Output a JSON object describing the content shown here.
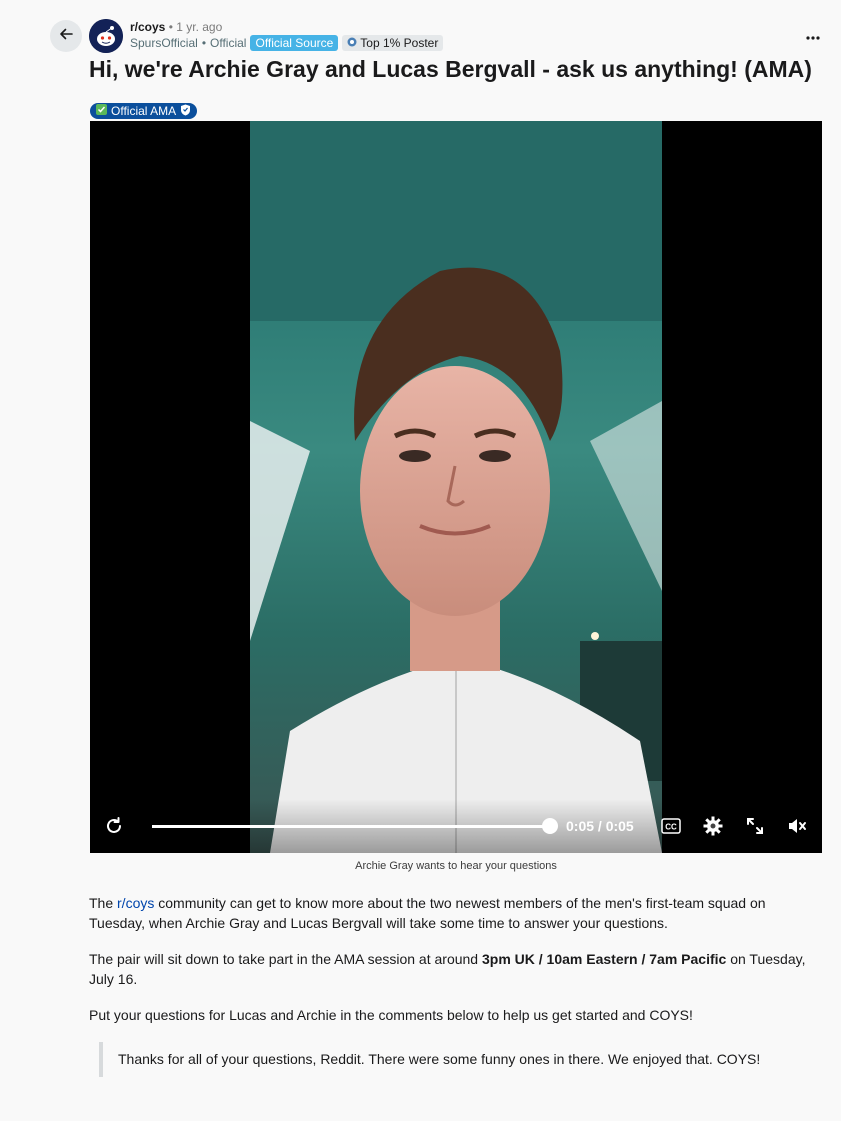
{
  "header": {
    "subreddit": "r/coys",
    "separator": "•",
    "time_ago": "1 yr. ago",
    "username": "SpursOfficial",
    "user_separator": "•",
    "user_label": "Official",
    "flair_source": "Official Source",
    "flair_top": "Top 1% Poster"
  },
  "post": {
    "title": "Hi, we're Archie Gray and Lucas Bergvall - ask us anything! (AMA)",
    "flair": "Official AMA"
  },
  "video": {
    "time_display": "0:05 / 0:05",
    "progress": 1.0,
    "cc_label": "CC",
    "caption": "Archie Gray wants to hear your questions"
  },
  "body": {
    "p1_pre": "The ",
    "p1_link": "r/coys",
    "p1_post": " community can get to know more about the two newest members of the men's first-team squad on Tuesday, when Archie Gray and Lucas Bergvall will take some time to answer your questions.",
    "p2_pre": "The pair will sit down to take part in the AMA session at around ",
    "p2_bold": "3pm UK / 10am Eastern / 7am Pacific",
    "p2_post": " on Tuesday, July 16.",
    "p3": "Put your questions for Lucas and Archie in the comments below to help us get started and COYS!",
    "quote": "Thanks for all of your questions, Reddit. There were some funny ones in there. We enjoyed that. COYS!"
  },
  "icons": {
    "back": "arrow-left-icon",
    "more": "more-horizontal-icon",
    "replay": "replay-icon",
    "cc": "closed-captions-icon",
    "settings": "gear-icon",
    "fullscreen": "fullscreen-icon",
    "mute": "volume-muted-icon"
  },
  "colors": {
    "flair_source_bg": "#46b3e6",
    "ama_flair_bg": "#0b4f9c",
    "link": "#0045ac"
  }
}
